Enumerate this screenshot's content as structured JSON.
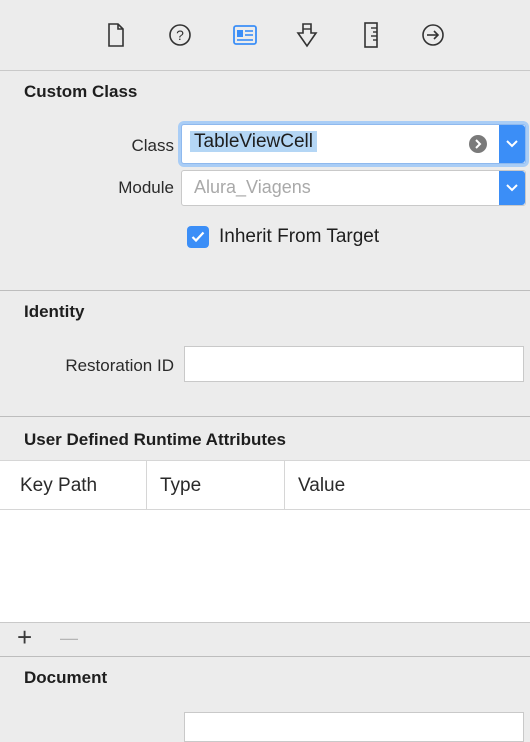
{
  "toolbar": {
    "icons": [
      "file-icon",
      "help-icon",
      "identity-inspector-icon",
      "attributes-inspector-icon",
      "size-inspector-icon",
      "connections-inspector-icon"
    ],
    "active_icon": "identity-inspector-icon"
  },
  "custom_class": {
    "title": "Custom Class",
    "class_label": "Class",
    "class_value": "TableViewCell",
    "module_label": "Module",
    "module_placeholder": "Alura_Viagens",
    "inherit_label": "Inherit From Target",
    "inherit_checked": true
  },
  "identity": {
    "title": "Identity",
    "restoration_label": "Restoration ID",
    "restoration_value": ""
  },
  "runtime_attributes": {
    "title": "User Defined Runtime Attributes",
    "columns": [
      "Key Path",
      "Type",
      "Value"
    ],
    "rows": [],
    "add_symbol": "+",
    "remove_symbol": "—"
  },
  "document": {
    "title": "Document"
  },
  "colors": {
    "accent": "#3b8ef7",
    "selection": "#b4d6f5",
    "panel": "#ececec"
  }
}
